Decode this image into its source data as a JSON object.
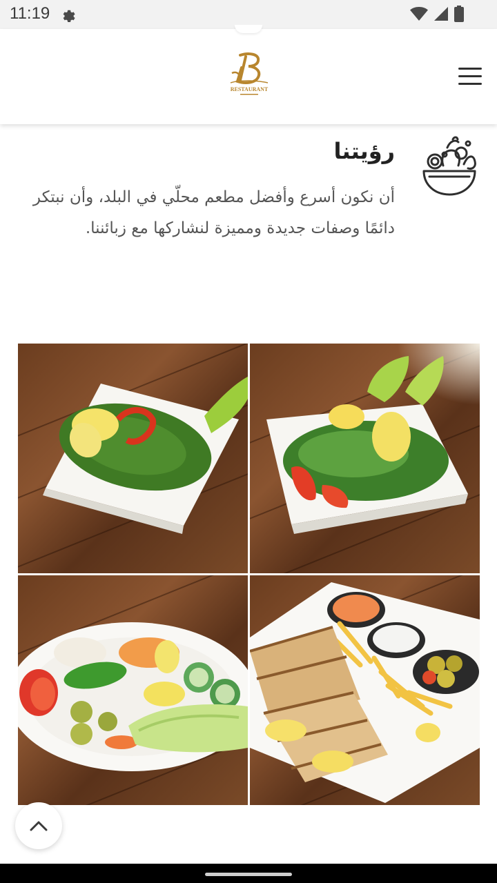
{
  "status_bar": {
    "time": "11:19",
    "icons": [
      "gear-icon",
      "wifi-icon",
      "signal-icon",
      "battery-icon"
    ]
  },
  "header": {
    "logo_text": "RESTAURANT",
    "logo_color": "#b8862e",
    "menu_icon": "hamburger-menu-icon"
  },
  "vision": {
    "icon": "salad-bowl-icon",
    "title": "رؤيتنا",
    "body": "أن نكون أسرع وأفضل مطعم محلّي في البلد، وأن نبتكر دائمًا وصفات جديدة ومميزة لنشاركها مع زبائننا."
  },
  "gallery": {
    "photos": [
      "tabbouleh",
      "green-salad",
      "pickles-vegetables-plate",
      "shawarma-fries-platter"
    ]
  },
  "scroll_top": {
    "icon": "chevron-up-icon"
  },
  "colors": {
    "accent": "#b8862e",
    "text_dark": "#222222",
    "text_body": "#555555"
  }
}
